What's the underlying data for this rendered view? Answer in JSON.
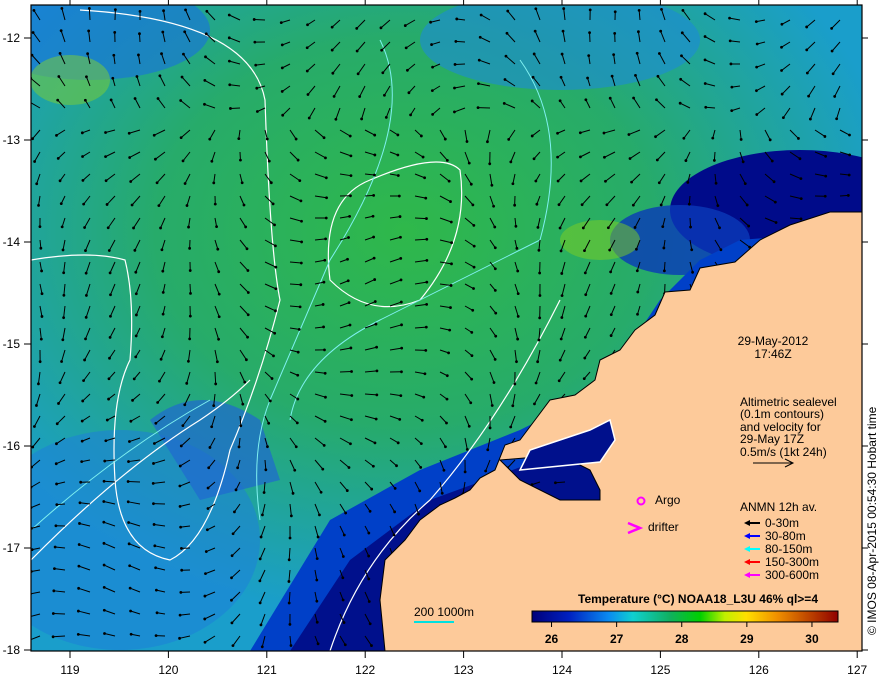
{
  "map": {
    "lon_range": [
      118.6,
      127
    ],
    "lat_range": [
      -18,
      -11.68
    ],
    "x_ticks": [
      "119",
      "120",
      "121",
      "122",
      "123",
      "124",
      "125",
      "126",
      "127"
    ],
    "y_ticks": [
      "-12",
      "-13",
      "-14",
      "-15",
      "-16",
      "-17",
      "-18"
    ],
    "land_color": "#fdca9a"
  },
  "datetime": {
    "date": "29-May-2012",
    "time": "17:46Z"
  },
  "altimetry_note": [
    "Altimetric sealevel",
    "(0.1m contours)",
    "and velocity for",
    "29-May 17Z",
    "0.5m/s (1kt 24h)"
  ],
  "markers": {
    "argo_label": "Argo",
    "drifter_label": "drifter",
    "argo_color": "#ff00ff",
    "drifter_color": "#ff00ff"
  },
  "anmn": {
    "title": "ANMN 12h av.",
    "items": [
      {
        "label": "0-30m",
        "color": "#000000"
      },
      {
        "label": "30-80m",
        "color": "#0000ff"
      },
      {
        "label": "80-150m",
        "color": "#00ffff"
      },
      {
        "label": "150-300m",
        "color": "#ff0000"
      },
      {
        "label": "300-600m",
        "color": "#ff00ff"
      }
    ]
  },
  "depth_contours_label": "200  1000m",
  "colorbar": {
    "title": "Temperature (°C) NOAA18_L3U 46% ql>=4",
    "range": [
      25.7,
      30.4
    ],
    "ticks": [
      "26",
      "27",
      "28",
      "29",
      "30"
    ]
  },
  "credit": "© IMOS 08-Apr-2015 00:54:30 Hobart time"
}
